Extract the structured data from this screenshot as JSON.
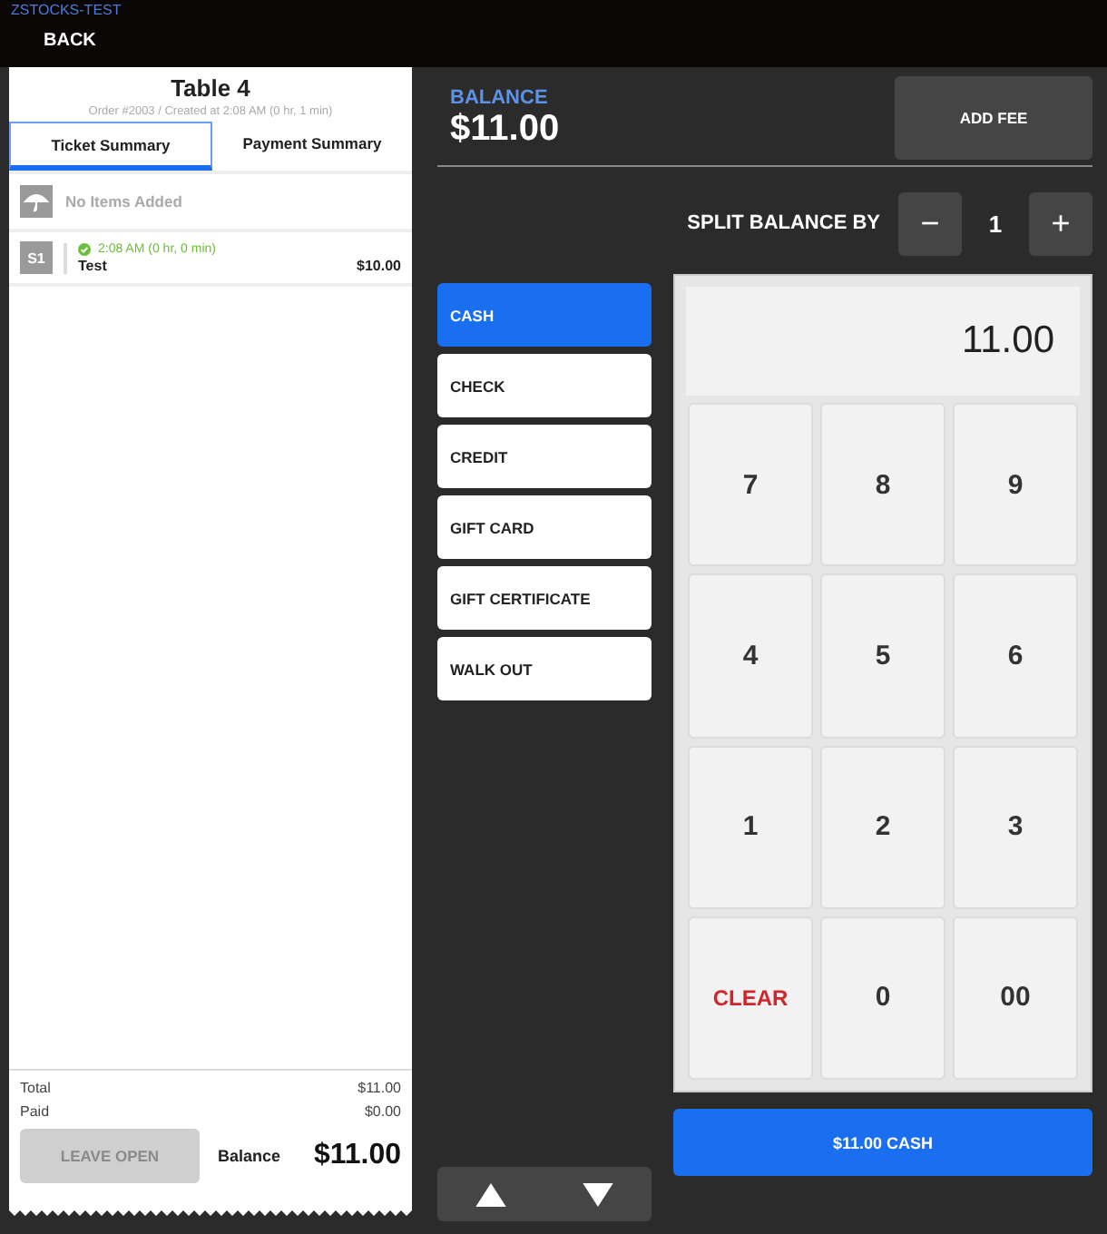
{
  "app_name": "ZSTOCKS-TEST",
  "back_button": "BACK",
  "ticket": {
    "title": "Table 4",
    "subtitle": "Order #2003 / Created at 2:08 AM (0 hr, 1 min)",
    "tabs": [
      {
        "label": "Ticket Summary",
        "selected": true
      },
      {
        "label": "Payment Summary",
        "selected": false
      }
    ],
    "empty_notice": "No Items Added",
    "seats": [
      {
        "badge": "S1",
        "time": "2:08 AM (0 hr, 0 min)",
        "item": "Test",
        "price": "$10.00"
      }
    ],
    "totals": [
      {
        "label": "Total",
        "value": "$11.00"
      },
      {
        "label": "Paid",
        "value": "$0.00"
      }
    ],
    "leave_open": {
      "label": "LEAVE OPEN",
      "disabled": true
    },
    "balance_label": "Balance",
    "balance_value": "$11.00"
  },
  "balance": {
    "label": "BALANCE",
    "value": "$11.00"
  },
  "add_fee": "ADD FEE",
  "split": {
    "label": "SPLIT BALANCE BY",
    "minus": "−",
    "count": "1",
    "plus": "+"
  },
  "methods": [
    {
      "label": "CASH",
      "selected": true
    },
    {
      "label": "CHECK",
      "selected": false
    },
    {
      "label": "CREDIT",
      "selected": false
    },
    {
      "label": "GIFT CARD",
      "selected": false
    },
    {
      "label": "GIFT CERTIFICATE",
      "selected": false
    },
    {
      "label": "WALK OUT",
      "selected": false
    }
  ],
  "display": "11.00",
  "keys": [
    {
      "label": "7",
      "kind": "digit"
    },
    {
      "label": "8",
      "kind": "digit"
    },
    {
      "label": "9",
      "kind": "digit"
    },
    {
      "label": "4",
      "kind": "digit"
    },
    {
      "label": "5",
      "kind": "digit"
    },
    {
      "label": "6",
      "kind": "digit"
    },
    {
      "label": "1",
      "kind": "digit"
    },
    {
      "label": "2",
      "kind": "digit"
    },
    {
      "label": "3",
      "kind": "digit"
    },
    {
      "label": "CLEAR",
      "kind": "clear"
    },
    {
      "label": "0",
      "kind": "digit"
    },
    {
      "label": "00",
      "kind": "digit"
    }
  ],
  "pay_button": "$11.00 CASH"
}
